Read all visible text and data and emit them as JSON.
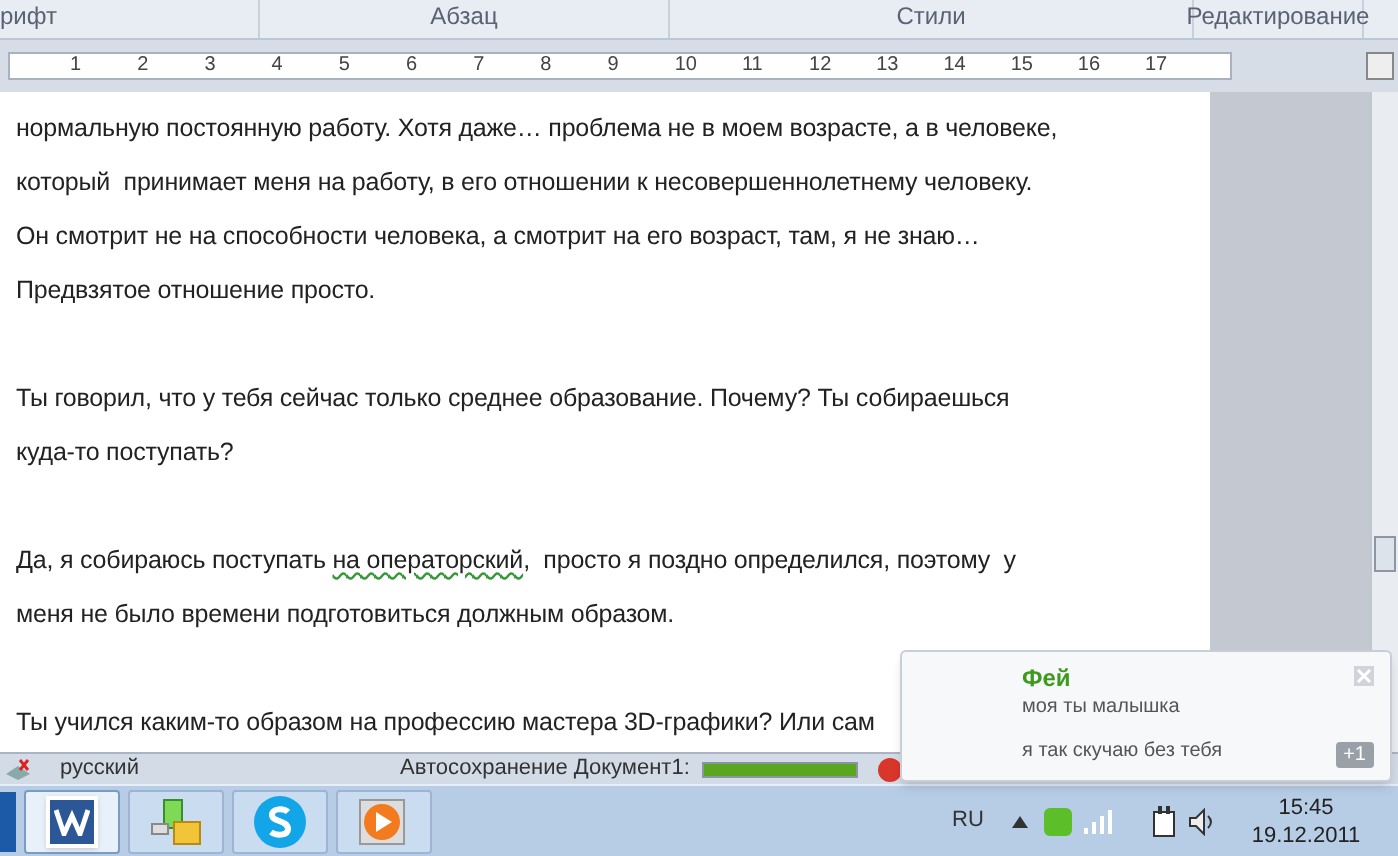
{
  "ribbon": {
    "groups": [
      {
        "label": "рифт"
      },
      {
        "label": "Абзац"
      },
      {
        "label": "Стили"
      },
      {
        "label": "Редактирование"
      }
    ]
  },
  "ruler": {
    "numbers": [
      "1",
      "2",
      "3",
      "4",
      "5",
      "6",
      "7",
      "8",
      "9",
      "10",
      "11",
      "12",
      "13",
      "14",
      "15",
      "16",
      "17"
    ]
  },
  "document": {
    "paragraphs": [
      [
        [
          {
            "text": "нормальную постоянную работу. Хотя даже… проблема не в моем возрасте, а в человеке,",
            "spellcheck": false
          }
        ],
        [
          {
            "text": "который  принимает меня на работу, в его отношении к несовершеннолетнему человеку.",
            "spellcheck": false
          }
        ],
        [
          {
            "text": "Он смотрит не на способности человека, а смотрит на его возраст, там, я не знаю…",
            "spellcheck": false
          }
        ],
        [
          {
            "text": "Предвзятое отношение просто.",
            "spellcheck": false
          }
        ]
      ],
      [
        [
          {
            "text": "Ты говорил, что у тебя сейчас только среднее образование. Почему? Ты собираешься",
            "spellcheck": false
          }
        ],
        [
          {
            "text": "куда-то поступать?",
            "spellcheck": false
          }
        ]
      ],
      [
        [
          {
            "text": "Да, я собираюсь поступать ",
            "spellcheck": false
          },
          {
            "text": "на операторский",
            "spellcheck": true
          },
          {
            "text": ",  просто я поздно определился, поэтому  у",
            "spellcheck": false
          }
        ],
        [
          {
            "text": "меня не было времени подготовиться должным образом.",
            "spellcheck": false
          }
        ]
      ],
      [
        [
          {
            "text": "Ты учился каким-то образом на профессию мастера 3D-графики? Или сам",
            "spellcheck": false
          }
        ]
      ]
    ]
  },
  "status_bar": {
    "language": "русский",
    "autosave": "Автосохранение Документ1:",
    "level": 1.0
  },
  "taskbar": {
    "apps": [
      {
        "kind": "word",
        "selected": true
      },
      {
        "kind": "app",
        "selected": false
      },
      {
        "kind": "skype",
        "selected": false
      },
      {
        "kind": "player",
        "selected": false
      }
    ],
    "language": "RU",
    "time": "15:45",
    "date": "19.12.2011"
  },
  "notification": {
    "sender": "Фей",
    "messages": [
      "моя ты малышка",
      "я так скучаю без тебя"
    ],
    "count": "+1"
  }
}
